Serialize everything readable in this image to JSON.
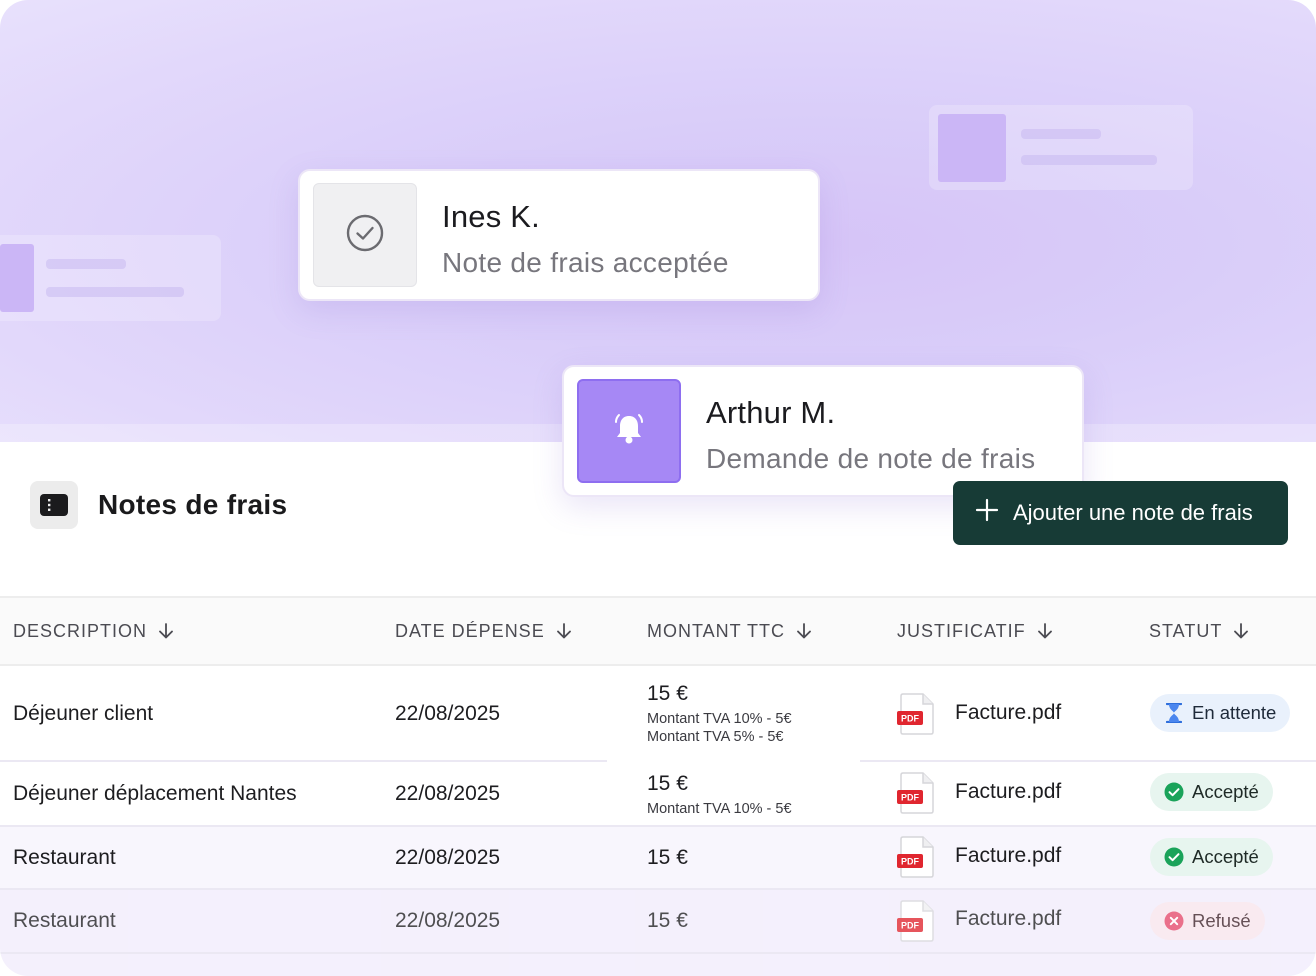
{
  "notifications": [
    {
      "name": "Ines K.",
      "message": "Note de frais acceptée",
      "icon": "check-circle-icon"
    },
    {
      "name": "Arthur M.",
      "message": "Demande de note de frais",
      "icon": "bell-icon"
    }
  ],
  "page": {
    "title": "Notes de frais",
    "icon": "receipt-icon",
    "add_button_label": "Ajouter une note de frais"
  },
  "table": {
    "columns": [
      "DESCRIPTION",
      "DATE DÉPENSE",
      "MONTANT TTC",
      "JUSTIFICATIF",
      "STATUT"
    ],
    "rows": [
      {
        "description": "Déjeuner client",
        "date": "22/08/2025",
        "amount": "15 €",
        "tva": [
          "Montant TVA 10% - 5€",
          "Montant TVA 5% - 5€"
        ],
        "file": "Facture.pdf",
        "status": "En attente"
      },
      {
        "description": "Déjeuner déplacement Nantes",
        "date": "22/08/2025",
        "amount": "15 €",
        "tva": [
          "Montant TVA 10% - 5€"
        ],
        "file": "Facture.pdf",
        "status": "Accepté"
      },
      {
        "description": "Restaurant",
        "date": "22/08/2025",
        "amount": "15 €",
        "tva": [],
        "file": "Facture.pdf",
        "status": "Accepté"
      },
      {
        "description": "Restaurant",
        "date": "22/08/2025",
        "amount": "15 €",
        "tva": [],
        "file": "Facture.pdf",
        "status": "Refusé"
      }
    ],
    "pdf_label": "PDF"
  },
  "colors": {
    "brand_dark": "#173b36",
    "accent_purple": "#a78bfa",
    "status_wait": "#3b82f6",
    "status_ok": "#16a34a",
    "status_refused": "#e5486b"
  }
}
